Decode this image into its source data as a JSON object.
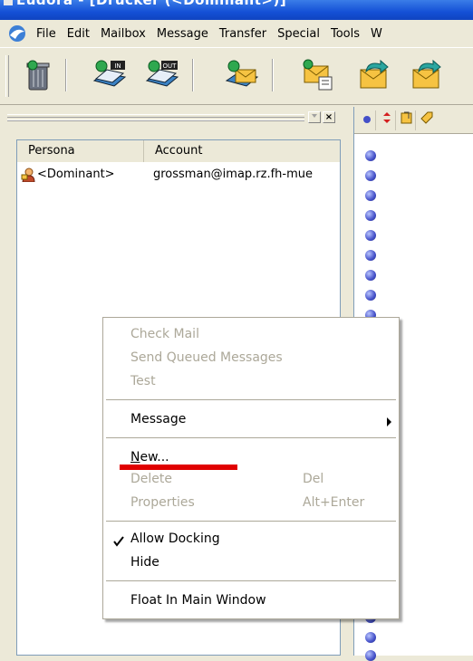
{
  "window": {
    "title": "Eudora - [Drucker (<Dominant>)]"
  },
  "menubar": {
    "items": [
      "File",
      "Edit",
      "Mailbox",
      "Message",
      "Transfer",
      "Special",
      "Tools",
      "W"
    ]
  },
  "toolbar": {
    "buttons": [
      {
        "icon": "trash-icon"
      },
      {
        "icon": "inbox-icon",
        "label": "IN"
      },
      {
        "icon": "outbox-icon",
        "label": "OUT"
      },
      {
        "icon": "check-mail-icon"
      },
      {
        "icon": "new-message-icon"
      },
      {
        "icon": "reply-icon"
      },
      {
        "icon": "reply-all-icon"
      }
    ]
  },
  "personas_panel": {
    "columns": [
      "Persona",
      "Account"
    ],
    "rows": [
      {
        "persona": "<Dominant>",
        "account": "grossman@imap.rz.fh-mue"
      }
    ],
    "close_glyph": "×"
  },
  "context_menu": {
    "items": [
      {
        "label": "Check Mail",
        "disabled": true
      },
      {
        "label": "Send Queued Messages",
        "disabled": true
      },
      {
        "label": "Test",
        "disabled": true
      },
      {
        "label": "Message",
        "submenu": true
      },
      {
        "label": "New...",
        "mnemonic": true
      },
      {
        "label": "Delete",
        "shortcut": "Del",
        "disabled": true
      },
      {
        "label": "Properties",
        "shortcut": "Alt+Enter",
        "disabled": true
      },
      {
        "label": "Allow Docking",
        "checked": true
      },
      {
        "label": "Hide"
      },
      {
        "label": "Float In Main Window"
      }
    ]
  },
  "annotation": {
    "color": "#e00000"
  }
}
